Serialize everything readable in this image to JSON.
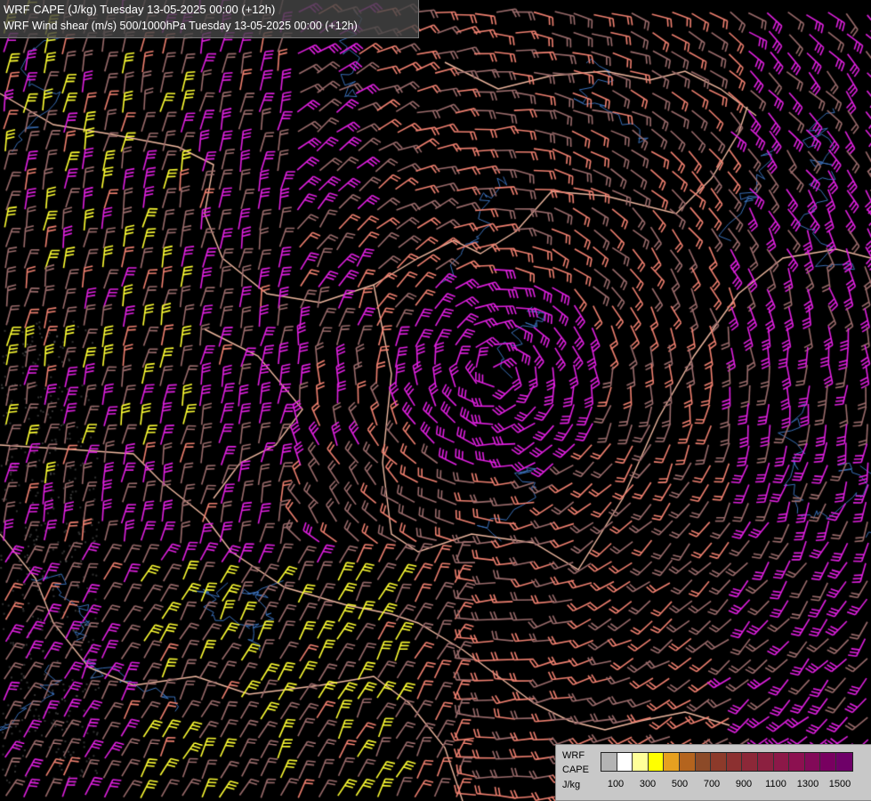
{
  "titles": {
    "line1": "WRF CAPE (J/kg) Tuesday 13-05-2025 00:00 (+12h)",
    "line2": "WRF Wind shear (m/s) 500/1000hPa Tuesday 13-05-2025 00:00 (+12h)"
  },
  "legend": {
    "labels": [
      "WRF",
      "CAPE",
      "J/kg"
    ],
    "ticks": [
      "100",
      "300",
      "500",
      "700",
      "900",
      "1100",
      "1300",
      "1500"
    ],
    "colors": [
      "#b4b4b4",
      "#ffffff",
      "#ffff99",
      "#ffff00",
      "#e6a020",
      "#b4641e",
      "#8c4a28",
      "#8c3a2a",
      "#8c3030",
      "#8c2838",
      "#8c2040",
      "#8c1848",
      "#8c1050",
      "#820a58",
      "#780060",
      "#6e0068"
    ]
  },
  "map": {
    "background": "#000000",
    "barb_colors": {
      "weak": "#9a6b6b",
      "moderate": "#f08070",
      "strong": "#e020e0",
      "cape": "#ffff33"
    },
    "border_color": "#f0b8a0",
    "river_color": "#3a6fb8"
  }
}
